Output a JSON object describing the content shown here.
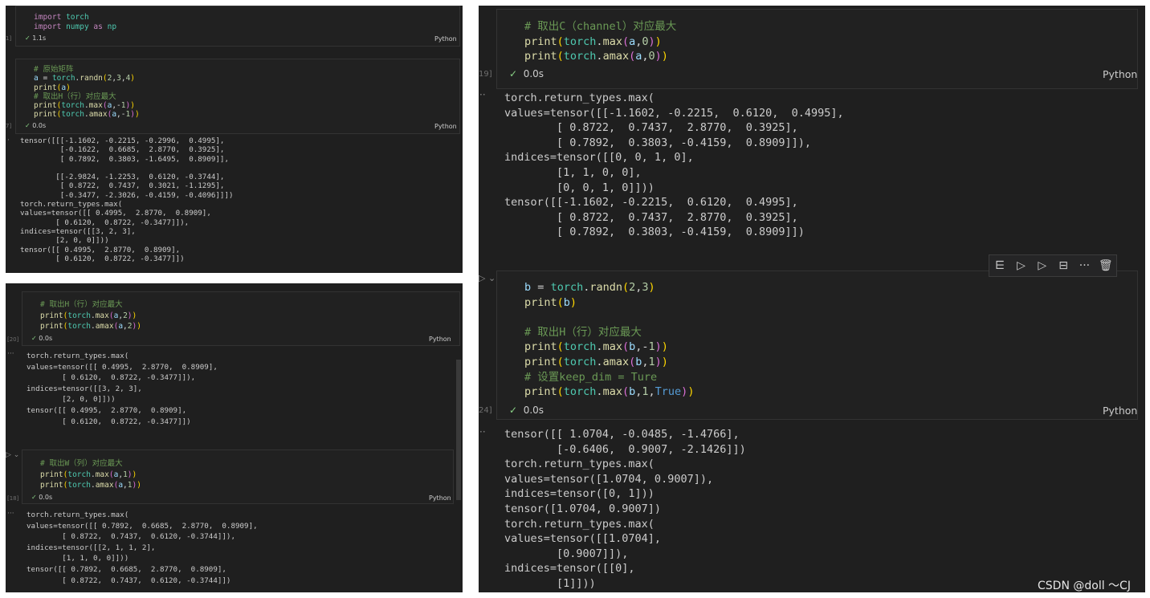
{
  "panel_a": {
    "cell1": {
      "lines": [
        "import torch",
        "import numpy as np"
      ],
      "exec_count": "1]",
      "time": "1.1s",
      "language": "Python"
    },
    "cell2": {
      "lines": [
        "# 原始矩阵",
        "a = torch.randn(2,3,4)",
        "print(a)",
        "# 取出H（行）对应最大",
        "print(torch.max(a,-1))",
        "print(torch.amax(a,-1))"
      ],
      "exec_count": "7]",
      "time": "0.0s",
      "language": "Python"
    },
    "output_marker": "·",
    "output": "tensor([[[-1.1602, -0.2215, -0.2996,  0.4995],\n         [-0.1622,  0.6685,  2.8770,  0.3925],\n         [ 0.7892,  0.3803, -1.6495,  0.8909]],\n\n        [[-2.9824, -1.2253,  0.6120, -0.3744],\n         [ 0.8722,  0.7437,  0.3021, -1.1295],\n         [-0.3477, -2.3026, -0.4159, -0.4096]]])\ntorch.return_types.max(\nvalues=tensor([[ 0.4995,  2.8770,  0.8909],\n        [ 0.6120,  0.8722, -0.3477]]),\nindices=tensor([[3, 2, 3],\n        [2, 0, 0]]))\ntensor([[ 0.4995,  2.8770,  0.8909],\n        [ 0.6120,  0.8722, -0.3477]])"
  },
  "panel_b": {
    "cell1": {
      "lines": [
        "# 取出H（行）对应最大",
        "print(torch.max(a,2))",
        "print(torch.amax(a,2))"
      ],
      "exec_count": "[20]",
      "time": "0.0s",
      "language": "Python"
    },
    "output1_marker": "···",
    "output1": "torch.return_types.max(\nvalues=tensor([[ 0.4995,  2.8770,  0.8909],\n        [ 0.6120,  0.8722, -0.3477]]),\nindices=tensor([[3, 2, 3],\n        [2, 0, 0]]))\ntensor([[ 0.4995,  2.8770,  0.8909],\n        [ 0.6120,  0.8722, -0.3477]])",
    "cell2": {
      "lines": [
        "# 取出W（列）对应最大",
        "print(torch.max(a,1))",
        "print(torch.amax(a,1))"
      ],
      "exec_count": "[18]",
      "time": "0.0s",
      "language": "Python"
    },
    "output2_marker": "···",
    "output2": "torch.return_types.max(\nvalues=tensor([[ 0.7892,  0.6685,  2.8770,  0.8909],\n        [ 0.8722,  0.7437,  0.6120, -0.3744]]),\nindices=tensor([[2, 1, 1, 2],\n        [1, 1, 0, 0]]))\ntensor([[ 0.7892,  0.6685,  2.8770,  0.8909],\n        [ 0.8722,  0.7437,  0.6120, -0.3744]])"
  },
  "panel_c": {
    "cell1": {
      "lines": [
        "# 取出C（channel）对应最大",
        "print(torch.max(a,0))",
        "print(torch.amax(a,0))"
      ],
      "exec_count": "19]",
      "time": "0.0s",
      "language": "Python"
    },
    "output1_marker": "··",
    "output1": "torch.return_types.max(\nvalues=tensor([[-1.1602, -0.2215,  0.6120,  0.4995],\n        [ 0.8722,  0.7437,  2.8770,  0.3925],\n        [ 0.7892,  0.3803, -0.4159,  0.8909]]),\nindices=tensor([[0, 0, 1, 0],\n        [1, 1, 0, 0],\n        [0, 0, 1, 0]]))\ntensor([[-1.1602, -0.2215,  0.6120,  0.4995],\n        [ 0.8722,  0.7437,  2.8770,  0.3925],\n        [ 0.7892,  0.3803, -0.4159,  0.8909]])",
    "cell2": {
      "lines": [
        "b = torch.randn(2,3)",
        "print(b)",
        "",
        "# 取出H（行）对应最大",
        "print(torch.max(b,-1))",
        "print(torch.amax(b,1))",
        "# 设置keep_dim = Ture",
        "print(torch.max(b,1,True))"
      ],
      "exec_count": "24]",
      "time": "0.0s",
      "language": "Python"
    },
    "output2_marker": "··",
    "output2": "tensor([[ 1.0704, -0.0485, -1.4766],\n        [-0.6406,  0.9007, -2.1426]])\ntorch.return_types.max(\nvalues=tensor([1.0704, 0.9007]),\nindices=tensor([0, 1]))\ntensor([1.0704, 0.9007])\ntorch.return_types.max(\nvalues=tensor([[1.0704],\n        [0.9007]]),\nindices=tensor([[0],\n        [1]]))",
    "toolbar_icons": [
      "run-by-line-icon",
      "execute-above-icon",
      "execute-below-icon",
      "split-cell-icon",
      "more-icon",
      "delete-icon"
    ],
    "run_cell_icon": "play-icon"
  },
  "watermark": "CSDN @doll ～CJ"
}
